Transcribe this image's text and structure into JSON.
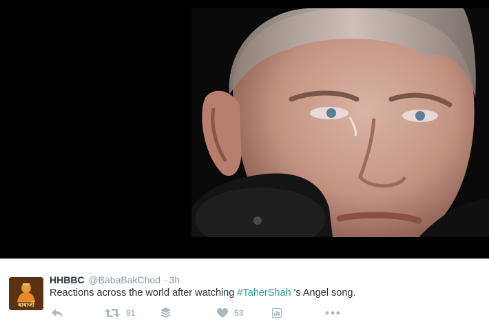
{
  "tweet": {
    "display_name": "HHBBC",
    "handle": "@BabaBakChod",
    "separator": "·",
    "time": "3h",
    "text_before": "Reactions across the world after watching ",
    "hashtag": "#TaherShah",
    "text_after": " 's Angel song.",
    "avatar_caption": "बाबाजी"
  },
  "actions": {
    "retweet_count": "91",
    "like_count": "53"
  },
  "colors": {
    "hashtag": "#2b9aa8",
    "icon_gray": "#aab8c2",
    "name": "#292f33",
    "meta": "#8899a6"
  },
  "icons": [
    "reply-icon",
    "retweet-icon",
    "buffer-icon",
    "heart-icon",
    "analytics-icon",
    "more-icon"
  ]
}
